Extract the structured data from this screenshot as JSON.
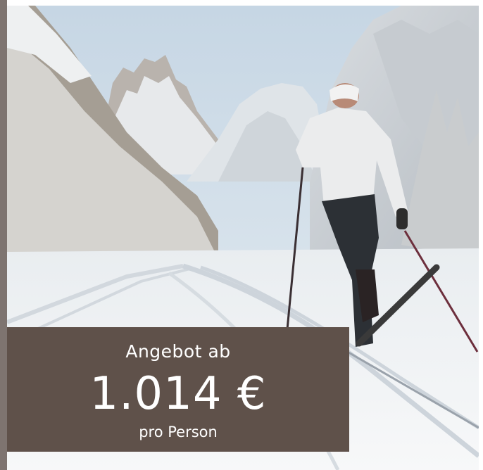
{
  "image": {
    "alt": "Langläufer auf einer verschneiten Loipe vor Bergen"
  },
  "offer": {
    "label": "Angebot ab",
    "price": "1.014 €",
    "per": "pro Person"
  },
  "colors": {
    "offer_background": "#5f514a",
    "offer_text": "#ffffff",
    "left_bar": "#7e7470"
  }
}
